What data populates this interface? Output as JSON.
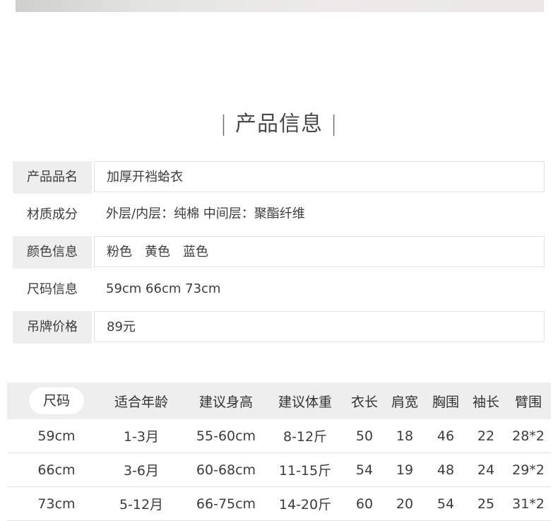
{
  "section_title": "产品信息",
  "product_info": [
    {
      "label": "产品品名",
      "value": "加厚开裆蛤衣"
    },
    {
      "label": "材质成分",
      "value": "外层/内层：纯棉 中间层：聚酯纤维"
    },
    {
      "label": "颜色信息",
      "value": "粉色　黄色　蓝色"
    },
    {
      "label": "尺码信息",
      "value": "59cm 66cm 73cm"
    },
    {
      "label": "吊牌价格",
      "value": "89元"
    }
  ],
  "size_table": {
    "headers": [
      "尺码",
      "适合年龄",
      "建议身高",
      "建议体重",
      "衣长",
      "肩宽",
      "胸围",
      "袖长",
      "臂围"
    ],
    "rows": [
      [
        "59cm",
        "1-3月",
        "55-60cm",
        "8-12斤",
        "50",
        "18",
        "46",
        "22",
        "28*2"
      ],
      [
        "66cm",
        "3-6月",
        "60-68cm",
        "11-15斤",
        "54",
        "19",
        "48",
        "24",
        "29*2"
      ],
      [
        "73cm",
        "5-12月",
        "66-75cm",
        "14-20斤",
        "60",
        "20",
        "54",
        "25",
        "31*2"
      ]
    ]
  }
}
